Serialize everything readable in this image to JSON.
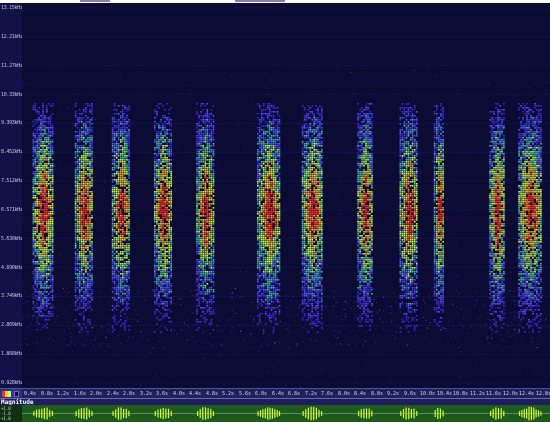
{
  "frequency_axis": {
    "ticks": [
      {
        "label": "13.15kHz"
      },
      {
        "label": "12.21kHz"
      },
      {
        "label": "11.27kHz"
      },
      {
        "label": "10.33kHz"
      },
      {
        "label": "9.393kHz"
      },
      {
        "label": "8.452kHz"
      },
      {
        "label": "7.512kHz"
      },
      {
        "label": "6.571kHz"
      },
      {
        "label": "5.630kHz"
      },
      {
        "label": "4.690kHz"
      },
      {
        "label": "3.749kHz"
      },
      {
        "label": "2.809kHz"
      },
      {
        "label": "1.868kHz"
      },
      {
        "label": "0.928kHz"
      }
    ]
  },
  "time_axis": {
    "ticks": [
      "0.4s",
      "0.8s",
      "1.2s",
      "1.6s",
      "2.0s",
      "2.4s",
      "2.8s",
      "3.2s",
      "3.6s",
      "4.0s",
      "4.4s",
      "4.8s",
      "5.2s",
      "5.6s",
      "6.0s",
      "6.4s",
      "6.8s",
      "7.2s",
      "7.6s",
      "8.0s",
      "8.4s",
      "8.8s",
      "9.2s",
      "9.6s",
      "10.0s",
      "10.4s",
      "10.8s",
      "11.2s",
      "11.6s",
      "12.0s",
      "12.4s",
      "12.8s"
    ]
  },
  "magnitude_bar": {
    "label": "Magnitude"
  },
  "waveform_axis": {
    "ticks": [
      "+1.0",
      "-1.0",
      "+1.0"
    ]
  },
  "colors": {
    "background": "#0b0b34",
    "low": "#3a2bd0",
    "mid": "#c8ff40",
    "high": "#ff3020",
    "waveform_bg": "#1e5a1e",
    "waveform_trace": "#d8ff30"
  },
  "bursts": [
    {
      "start": 0.02,
      "end": 0.06
    },
    {
      "start": 0.1,
      "end": 0.135
    },
    {
      "start": 0.17,
      "end": 0.205
    },
    {
      "start": 0.25,
      "end": 0.285
    },
    {
      "start": 0.33,
      "end": 0.365
    },
    {
      "start": 0.445,
      "end": 0.49
    },
    {
      "start": 0.53,
      "end": 0.57
    },
    {
      "start": 0.635,
      "end": 0.665
    },
    {
      "start": 0.715,
      "end": 0.75
    },
    {
      "start": 0.78,
      "end": 0.8
    },
    {
      "start": 0.885,
      "end": 0.915
    },
    {
      "start": 0.94,
      "end": 0.985
    }
  ]
}
